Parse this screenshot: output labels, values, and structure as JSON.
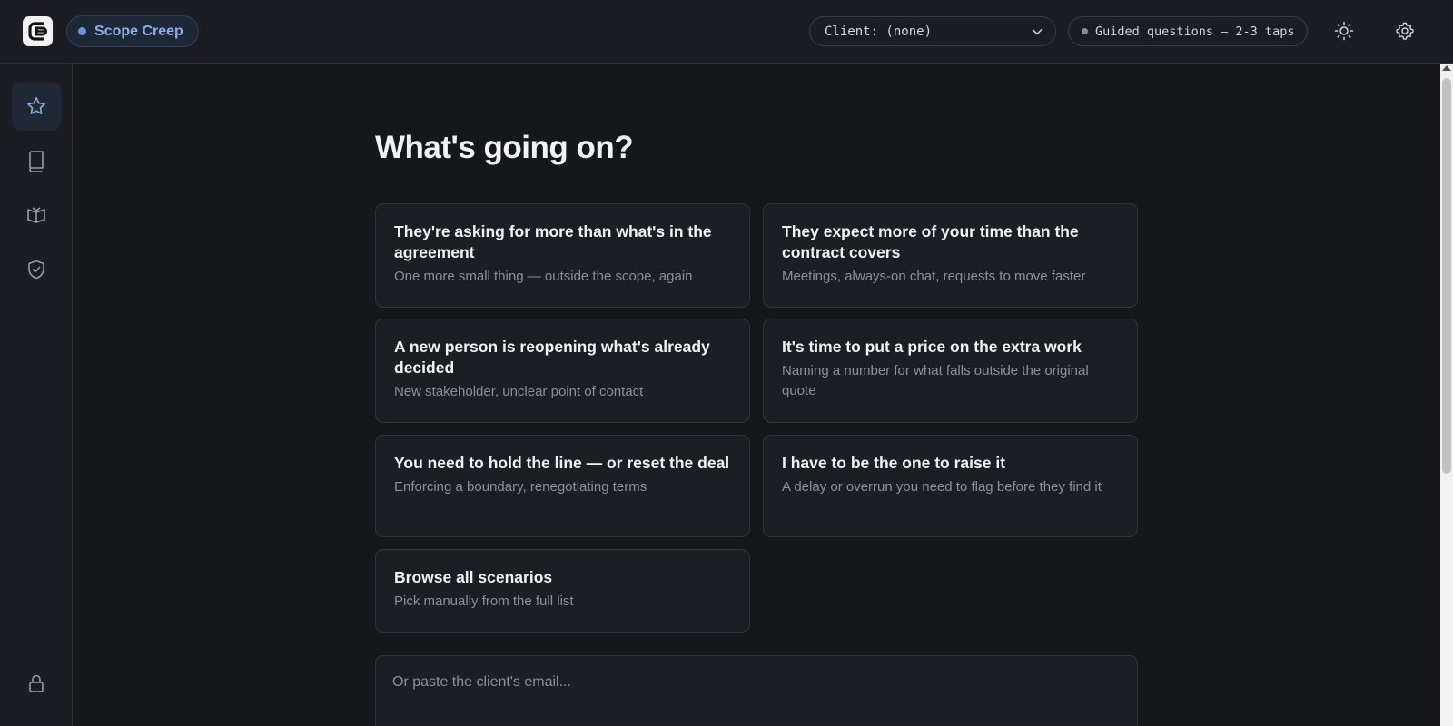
{
  "header": {
    "mode_label": "Scope Creep",
    "client_select": "Client: (none)",
    "guided_label": "Guided questions — 2-3 taps",
    "accent_color": "#8fb0e6"
  },
  "sidebar": {
    "items": [
      {
        "icon": "star-icon",
        "active": true
      },
      {
        "icon": "book-icon",
        "active": false
      },
      {
        "icon": "open-book-icon",
        "active": false
      },
      {
        "icon": "shield-check-icon",
        "active": false
      }
    ],
    "bottom_icon": "lock-icon"
  },
  "main": {
    "heading": "What's going on?",
    "cards": [
      {
        "title": "They're asking for more than what's in the agreement",
        "subtitle": "One more small thing — outside the scope, again"
      },
      {
        "title": "They expect more of your time than the contract covers",
        "subtitle": "Meetings, always-on chat, requests to move faster"
      },
      {
        "title": "A new person is reopening what's already decided",
        "subtitle": "New stakeholder, unclear point of contact"
      },
      {
        "title": "It's time to put a price on the extra work",
        "subtitle": "Naming a number for what falls outside the original quote"
      },
      {
        "title": "You need to hold the line — or reset the deal",
        "subtitle": "Enforcing a boundary, renegotiating terms"
      },
      {
        "title": "I have to be the one to raise it",
        "subtitle": "A delay or overrun you need to flag before they find it"
      },
      {
        "title": "Browse all scenarios",
        "subtitle": "Pick manually from the full list"
      }
    ],
    "email_placeholder": "Or paste the client's email..."
  }
}
